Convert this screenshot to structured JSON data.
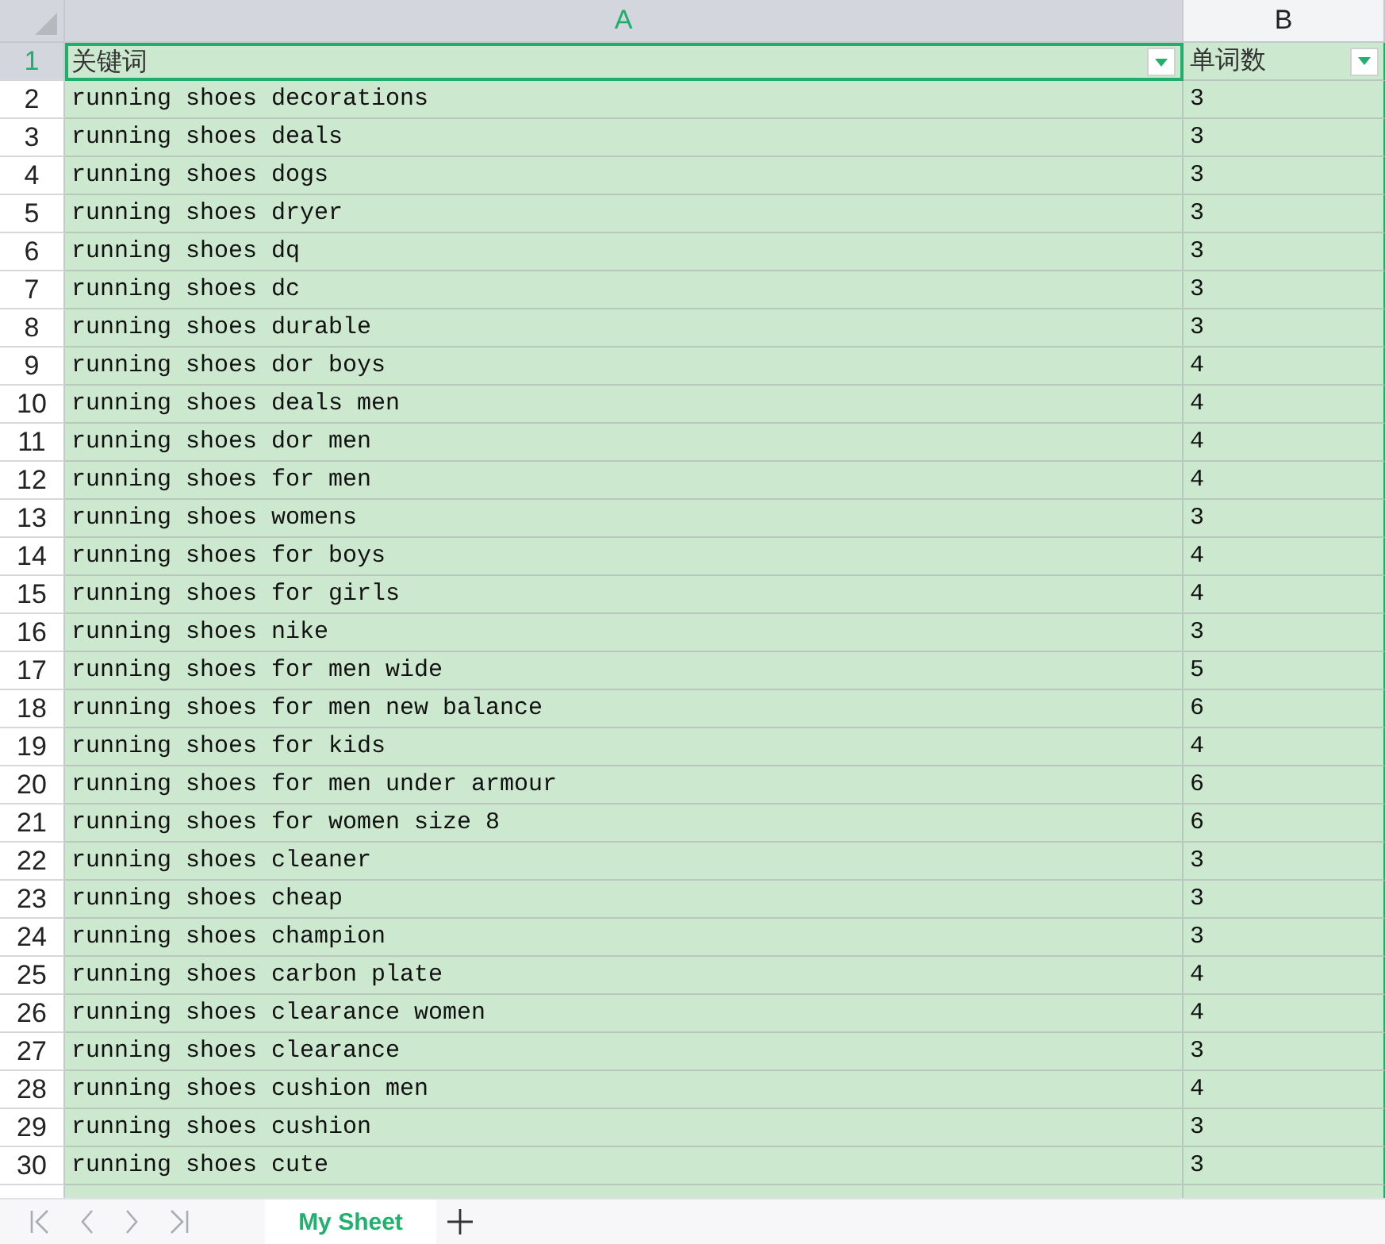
{
  "columns": [
    {
      "label": "A",
      "selected": true
    },
    {
      "label": "B",
      "selected": false
    }
  ],
  "header_row": {
    "number": "1",
    "selected": true,
    "cells": [
      {
        "text": "关键词",
        "filter": true,
        "selected": true
      },
      {
        "text": "单词数",
        "filter": true,
        "selected": false
      }
    ]
  },
  "rows": [
    {
      "number": "2",
      "cells": [
        "running shoes decorations",
        "3"
      ]
    },
    {
      "number": "3",
      "cells": [
        "running shoes deals",
        "3"
      ]
    },
    {
      "number": "4",
      "cells": [
        "running shoes dogs",
        "3"
      ]
    },
    {
      "number": "5",
      "cells": [
        "running shoes dryer",
        "3"
      ]
    },
    {
      "number": "6",
      "cells": [
        "running shoes dq",
        "3"
      ]
    },
    {
      "number": "7",
      "cells": [
        "running shoes dc",
        "3"
      ]
    },
    {
      "number": "8",
      "cells": [
        "running shoes durable",
        "3"
      ]
    },
    {
      "number": "9",
      "cells": [
        "running shoes dor boys",
        "4"
      ]
    },
    {
      "number": "10",
      "cells": [
        "running shoes deals men",
        "4"
      ]
    },
    {
      "number": "11",
      "cells": [
        "running shoes dor men",
        "4"
      ]
    },
    {
      "number": "12",
      "cells": [
        "running shoes for men",
        "4"
      ]
    },
    {
      "number": "13",
      "cells": [
        "running shoes womens",
        "3"
      ]
    },
    {
      "number": "14",
      "cells": [
        "running shoes for boys",
        "4"
      ]
    },
    {
      "number": "15",
      "cells": [
        "running shoes for girls",
        "4"
      ]
    },
    {
      "number": "16",
      "cells": [
        "running shoes nike",
        "3"
      ]
    },
    {
      "number": "17",
      "cells": [
        "running shoes for men wide",
        "5"
      ]
    },
    {
      "number": "18",
      "cells": [
        "running shoes for men new balance",
        "6"
      ]
    },
    {
      "number": "19",
      "cells": [
        "running shoes for kids",
        "4"
      ]
    },
    {
      "number": "20",
      "cells": [
        "running shoes for men under armour",
        "6"
      ]
    },
    {
      "number": "21",
      "cells": [
        "running shoes for women size 8",
        "6"
      ]
    },
    {
      "number": "22",
      "cells": [
        "running shoes cleaner",
        "3"
      ]
    },
    {
      "number": "23",
      "cells": [
        "running shoes cheap",
        "3"
      ]
    },
    {
      "number": "24",
      "cells": [
        "running shoes champion",
        "3"
      ]
    },
    {
      "number": "25",
      "cells": [
        "running shoes carbon plate",
        "4"
      ]
    },
    {
      "number": "26",
      "cells": [
        "running shoes clearance women",
        "4"
      ]
    },
    {
      "number": "27",
      "cells": [
        "running shoes clearance",
        "3"
      ]
    },
    {
      "number": "28",
      "cells": [
        "running shoes cushion men",
        "4"
      ]
    },
    {
      "number": "29",
      "cells": [
        "running shoes cushion",
        "3"
      ]
    },
    {
      "number": "30",
      "cells": [
        "running shoes cute",
        "3"
      ]
    }
  ],
  "sheet_tabs": [
    {
      "label": "My Sheet",
      "selected": true
    }
  ]
}
